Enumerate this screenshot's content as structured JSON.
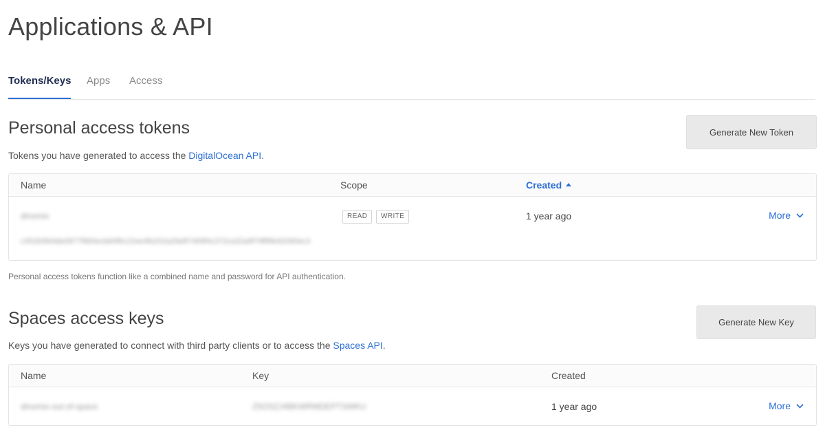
{
  "page": {
    "title": "Applications & API"
  },
  "tabs": [
    {
      "label": "Tokens/Keys",
      "active": true
    },
    {
      "label": "Apps",
      "active": false
    },
    {
      "label": "Access",
      "active": false
    }
  ],
  "personal_tokens": {
    "title": "Personal access tokens",
    "desc_prefix": "Tokens you have generated to access the ",
    "desc_link": "DigitalOcean API",
    "desc_suffix": ".",
    "generate_button": "Generate New Token",
    "columns": {
      "name": "Name",
      "scope": "Scope",
      "created": "Created"
    },
    "rows": [
      {
        "name": "dinomix",
        "token": "c352b5fe9de0877f9b5ecb84f6c22ee4fe202a2fa9f7469f4c372ca32a9f79ff9fe92060ec3",
        "scopes": [
          "READ",
          "WRITE"
        ],
        "created": "1 year ago",
        "more": "More"
      }
    ],
    "note": "Personal access tokens function like a combined name and password for API authentication."
  },
  "spaces_keys": {
    "title": "Spaces access keys",
    "desc_prefix": "Keys you have generated to connect with third party clients or to access the ",
    "desc_link": "Spaces API",
    "desc_suffix": ".",
    "generate_button": "Generate New Key",
    "columns": {
      "name": "Name",
      "key": "Key",
      "created": "Created"
    },
    "rows": [
      {
        "name": "dinomix-out-of-space",
        "key": "Z5OSZJ4BKWRMDEPTSWKU",
        "created": "1 year ago",
        "more": "More"
      }
    ]
  },
  "colors": {
    "accent": "#2d6fd6",
    "tab_active": "#1f2d52",
    "button_bg": "#e9e9e9"
  },
  "icons": {
    "sort": "caret-up-icon",
    "more": "chevron-down-icon"
  }
}
